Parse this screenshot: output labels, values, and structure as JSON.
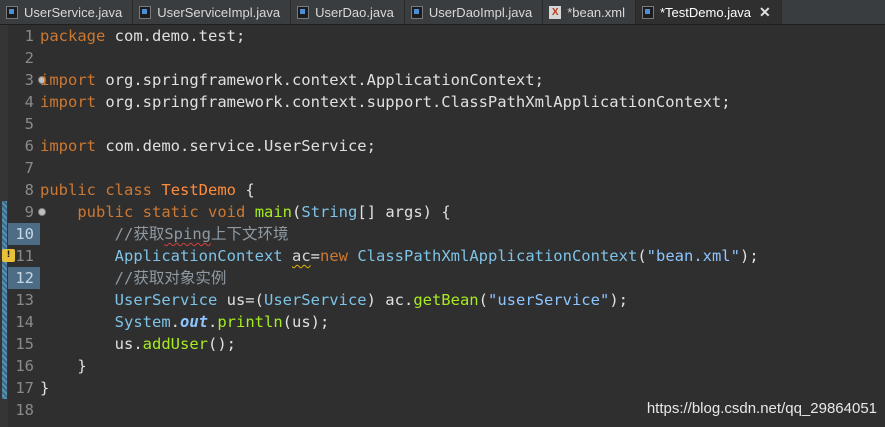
{
  "tabs": [
    {
      "label": "UserService.java",
      "active": false,
      "icon": "java-file-icon"
    },
    {
      "label": "UserServiceImpl.java",
      "active": false,
      "icon": "java-file-icon"
    },
    {
      "label": "UserDao.java",
      "active": false,
      "icon": "java-file-icon"
    },
    {
      "label": "UserDaoImpl.java",
      "active": false,
      "icon": "java-file-icon"
    },
    {
      "label": "*bean.xml",
      "active": false,
      "icon": "xml-file-icon"
    },
    {
      "label": "*TestDemo.java",
      "active": true,
      "icon": "java-file-icon",
      "close": "✕"
    }
  ],
  "line_numbers": [
    "1",
    "2",
    "3",
    "4",
    "5",
    "6",
    "7",
    "8",
    "9",
    "10",
    "11",
    "12",
    "13",
    "14",
    "15",
    "16",
    "17",
    "18"
  ],
  "code": {
    "l1": {
      "kw": "package",
      "rest": " com.demo.test;"
    },
    "l3": {
      "kw": "import",
      "rest": " org.springframework.context.ApplicationContext;"
    },
    "l4": {
      "kw": "import",
      "rest": " org.springframework.context.support.ClassPathXmlApplicationContext;"
    },
    "l6": {
      "kw": "import",
      "rest": " com.demo.service.UserService;"
    },
    "l8": {
      "kw1": "public",
      "kw2": "class",
      "cls": "TestDemo",
      "rest": " {"
    },
    "l9": {
      "kw1": "public",
      "kw2": "static",
      "kw3": "void",
      "fn": "main",
      "p1": "(",
      "ty": "String",
      "p2": "[] args) {"
    },
    "l10": {
      "pre": "//获取",
      "sq": "Sping",
      "post": "上下文环境"
    },
    "l11": {
      "ty1": "ApplicationContext",
      "sp": " ",
      "var": "ac",
      "eq": "=",
      "kw": "new",
      "ty2": "ClassPathXmlApplicationContext",
      "p1": "(",
      "str": "\"bean.xml\"",
      "p2": ");"
    },
    "l12": {
      "cm": "//获取对象实例"
    },
    "l13": {
      "ty1": "UserService",
      "v1": " us=(",
      "ty2": "UserService",
      "v2": ") ac.",
      "fn": "getBean",
      "p1": "(",
      "str": "\"userService\"",
      "p2": ");"
    },
    "l14": {
      "ty": "System",
      "dot": ".",
      "st": "out",
      "dot2": ".",
      "fn": "println",
      "p": "(us);"
    },
    "l15": {
      "v": "us.",
      "fn": "addUser",
      "p": "();"
    },
    "l16": {
      "t": "}"
    },
    "l17": {
      "t": "}"
    }
  },
  "watermark": "https://blog.csdn.net/qq_29864051",
  "colors": {
    "keyword": "#cc7832",
    "type": "#7ec3e6",
    "class": "#ff8c3a",
    "method": "#a7ec21",
    "string": "#8ec5ff",
    "comment": "#8f9aa3"
  }
}
